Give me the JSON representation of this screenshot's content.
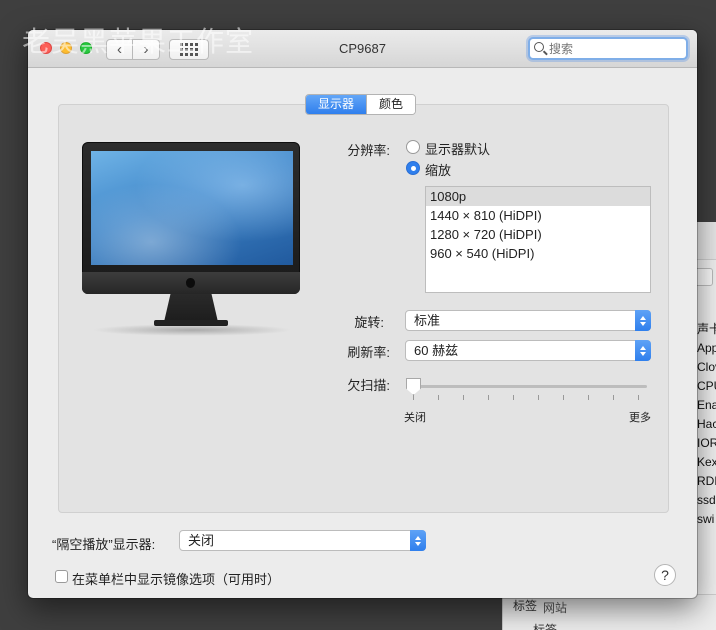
{
  "watermark": "老吴黑苹果工作室",
  "window": {
    "title": "CP9687",
    "search_placeholder": "搜索"
  },
  "toolbar": {
    "back_label": "‹",
    "forward_label": "›"
  },
  "tabs": [
    {
      "label": "显示器",
      "active": true
    },
    {
      "label": "颜色",
      "active": false
    }
  ],
  "resolution": {
    "label": "分辨率:",
    "options": [
      {
        "label": "显示器默认",
        "selected": false
      },
      {
        "label": "缩放",
        "selected": true
      }
    ],
    "list": [
      "1080p",
      "1440 × 810 (HiDPI)",
      "1280 × 720 (HiDPI)",
      "960 × 540 (HiDPI)"
    ],
    "selected_index": 0
  },
  "rotation": {
    "label": "旋转:",
    "value": "标准"
  },
  "refresh": {
    "label": "刷新率:",
    "value": "60 赫兹"
  },
  "underscan": {
    "label": "欠扫描:",
    "min_label": "关闭",
    "max_label": "更多",
    "value": 0
  },
  "airplay": {
    "label": "“隔空播放”显示器:",
    "value": "关闭"
  },
  "mirror_option": {
    "label": "在菜单栏中显示镜像选项（可用时）",
    "checked": false
  },
  "help_label": "?",
  "background_window": {
    "list": [
      "声卡",
      "App",
      "Clov",
      "CPU",
      "Ena",
      "Hac",
      "IOR",
      "Kex",
      "RDM",
      "ssd",
      "swi"
    ],
    "bottom_tag": "标签",
    "bottom_tag2": "标签",
    "bottom_blur": "网站"
  },
  "colors": {
    "accent": "#2f7fed",
    "window_bg": "#ececec",
    "desktop_bg": "#3f3f3f"
  }
}
